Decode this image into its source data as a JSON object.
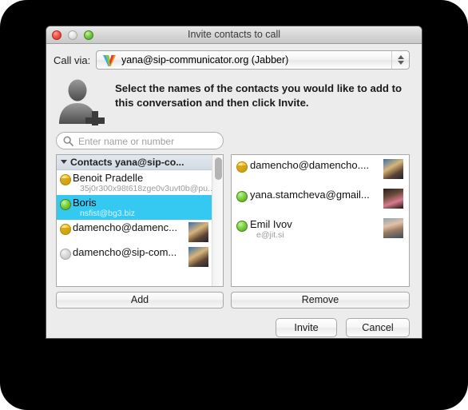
{
  "window": {
    "title": "Invite contacts to call",
    "traffic_lights": {
      "close": "close-button",
      "minimize": "minimize-button",
      "zoom": "zoom-button"
    }
  },
  "call_via": {
    "label": "Call via:",
    "account": "yana@sip-communicator.org (Jabber)",
    "logo_icon": "jitsi-logo-icon",
    "stepper_icon": "stepper-arrows-icon"
  },
  "instruction": {
    "icon": "person-add-icon",
    "text": "Select the names of the contacts you would like to add to this conversation and then click Invite."
  },
  "search": {
    "icon": "search-icon",
    "placeholder": "Enter name or number",
    "value": ""
  },
  "left_list": {
    "group": {
      "label": "Contacts yana@sip-co...",
      "chevron_icon": "chevron-down-icon",
      "expanded": true
    },
    "rows": [
      {
        "name": "Benoit Pradelle",
        "sub": "35j0r300x98t618zge0v3uvt0b@pu...",
        "status": "away",
        "selected": false,
        "avatar": null
      },
      {
        "name": "Boris",
        "sub": "nsfist@bg3.biz",
        "status": "online",
        "selected": true,
        "avatar": null
      },
      {
        "name": "damencho@damenc...",
        "sub": "",
        "status": "away",
        "selected": false,
        "avatar": "av-a"
      },
      {
        "name": "damencho@sip-com...",
        "sub": "",
        "status": "offline",
        "selected": false,
        "avatar": "av-a"
      }
    ],
    "scrollbar": "vertical-scrollbar"
  },
  "right_list": {
    "rows": [
      {
        "name": "damencho@damencho....",
        "sub": "",
        "status": "away",
        "avatar": "av-a"
      },
      {
        "name": "yana.stamcheva@gmail...",
        "sub": "",
        "status": "online",
        "avatar": "av-b"
      },
      {
        "name": "Emil Ivov",
        "sub": "e@jit.si",
        "status": "online",
        "avatar": "av-c"
      }
    ]
  },
  "buttons": {
    "add": "Add",
    "remove": "Remove",
    "invite": "Invite",
    "cancel": "Cancel"
  },
  "colors": {
    "selection": "#35c9f2",
    "window_bg": "#ececec",
    "status_online": "#7ed040",
    "status_away": "#f5c520",
    "status_offline": "#d9d9d9",
    "desktop": "#000000"
  }
}
